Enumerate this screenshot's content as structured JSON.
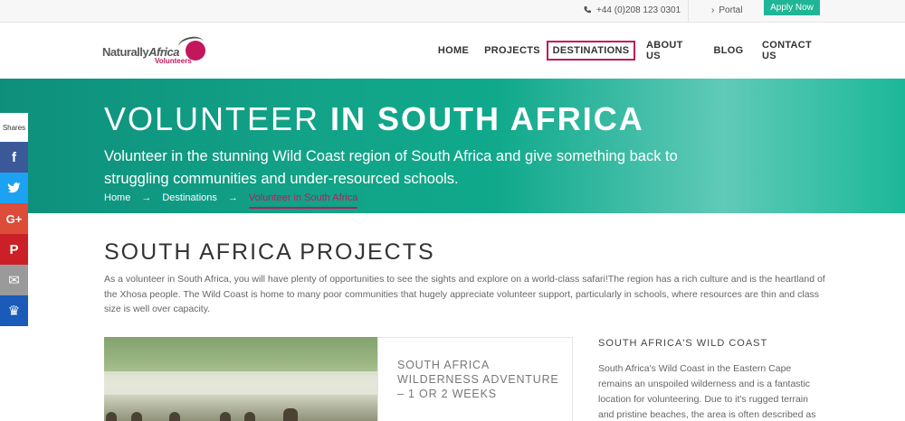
{
  "topbar": {
    "phone": "+44 (0)208 123 0301",
    "portal": "Portal",
    "apply": "Apply Now"
  },
  "header": {
    "logo_line1": "Naturally",
    "logo_line1b": "Africa",
    "logo_line2": "Volunteers",
    "nav": [
      "HOME",
      "PROJECTS",
      "DESTINATIONS",
      "ABOUT US",
      "BLOG",
      "CONTACT US"
    ],
    "active_nav": "DESTINATIONS"
  },
  "hero": {
    "title_light": "VOLUNTEER ",
    "title_bold": "IN SOUTH AFRICA",
    "subtitle": "Volunteer in the stunning Wild Coast region of South Africa and give something back to struggling communities and under-resourced schools.",
    "breadcrumb": [
      "Home",
      "Destinations",
      "Volunteer in South Africa"
    ],
    "arrow": "→"
  },
  "share": {
    "label": "Shares",
    "buttons": [
      {
        "icon": "facebook-icon",
        "glyph": "f",
        "color": "#3b5998"
      },
      {
        "icon": "twitter-icon",
        "glyph": "🐦",
        "color": "#1da1f2"
      },
      {
        "icon": "google-plus-icon",
        "glyph": "G+",
        "color": "#dd4b39"
      },
      {
        "icon": "pinterest-icon",
        "glyph": "P",
        "color": "#cb2027"
      },
      {
        "icon": "email-icon",
        "glyph": "✉",
        "color": "#9a9a9a"
      },
      {
        "icon": "sumo-icon",
        "glyph": "♛",
        "color": "#1a5ab8"
      }
    ]
  },
  "content": {
    "section_title": "SOUTH AFRICA PROJECTS",
    "intro": "As a volunteer in South Africa, you will have plenty of opportunities to see the sights and explore on a world-class safari!The region has a rich culture and is the heartland of the Xhosa people. The Wild Coast is home to many poor communities that hugely appreciate volunteer support, particularly in schools, where resources are thin and class size is well over capacity.",
    "card_title": "SOUTH AFRICA WILDERNESS ADVENTURE – 1 OR 2 WEEKS",
    "side_title": "SOUTH AFRICA'S WILD COAST",
    "side_text": "South Africa's Wild Coast in the Eastern Cape remains an unspoiled wilderness and is a fantastic location for volunteering. Due to it's rugged terrain and pristine beaches, the area is often described as one of the"
  },
  "colors": {
    "accent": "#1fb596",
    "brand": "#c2185b",
    "hero": "#12a388"
  }
}
